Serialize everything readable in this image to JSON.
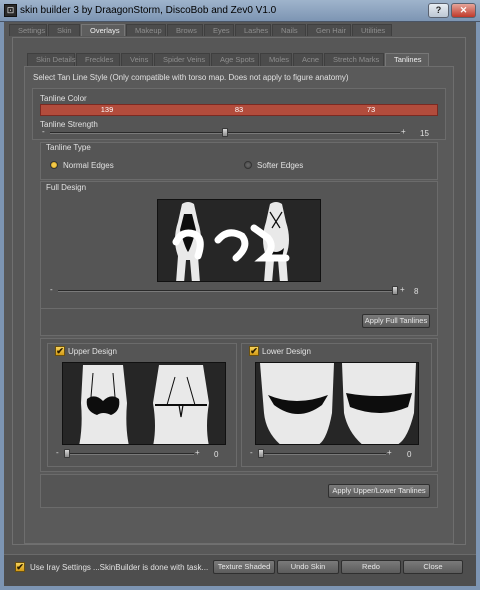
{
  "window": {
    "title": "skin builder 3 by DraagonStorm, DiscoBob and Zev0 V1.0",
    "help_glyph": "?",
    "close_glyph": "✕",
    "app_glyph": "⊡"
  },
  "main_tabs": [
    {
      "label": "Settings",
      "active": false
    },
    {
      "label": "Skin",
      "active": false
    },
    {
      "label": "Overlays",
      "active": true
    },
    {
      "label": "Makeup",
      "active": false
    },
    {
      "label": "Brows",
      "active": false
    },
    {
      "label": "Eyes",
      "active": false
    },
    {
      "label": "Lashes",
      "active": false
    },
    {
      "label": "Nails",
      "active": false
    },
    {
      "label": "Gen Hair",
      "active": false
    },
    {
      "label": "Utilities",
      "active": false
    }
  ],
  "sub_tabs": [
    {
      "label": "Skin Details",
      "active": false
    },
    {
      "label": "Freckles",
      "active": false
    },
    {
      "label": "Veins",
      "active": false
    },
    {
      "label": "Spider Veins",
      "active": false
    },
    {
      "label": "Age Spots",
      "active": false
    },
    {
      "label": "Moles",
      "active": false
    },
    {
      "label": "Acne",
      "active": false
    },
    {
      "label": "Stretch Marks",
      "active": false
    },
    {
      "label": "Tanlines",
      "active": true
    }
  ],
  "tanlines": {
    "hint": "Select Tan Line Style (Only compatible with  torso map. Does not apply to figure anatomy)",
    "color_label": "Tanline Color",
    "color_values": [
      "139",
      "83",
      "73"
    ],
    "color_hex": "#b24c3c",
    "strength_label": "Tanline Strength",
    "strength_value": "15",
    "strength_fraction": 0.5,
    "minus": "-",
    "plus": "+",
    "type_label": "Tanline Type",
    "type_options": [
      {
        "label": "Normal Edges",
        "selected": true
      },
      {
        "label": "Softer Edges",
        "selected": false
      }
    ],
    "full_design_label": "Full Design",
    "full_design_value": "8",
    "full_design_fraction": 1.0,
    "apply_full_button": "Apply Full Tanlines",
    "upper_design_label": "Upper Design",
    "upper_design_checked": true,
    "upper_design_value": "0",
    "upper_design_fraction": 0.0,
    "lower_design_label": "Lower Design",
    "lower_design_checked": true,
    "lower_design_value": "0",
    "lower_design_fraction": 0.0,
    "apply_upper_lower_button": "Apply Upper/Lower Tanlines",
    "check_glyph": "✔"
  },
  "footer": {
    "use_iray_label": "Use Iray Settings",
    "use_iray_checked": true,
    "status": "...SkinBuilder is done with task...",
    "buttons": [
      "Texture Shaded",
      "Undo Skin",
      "Redo",
      "Close"
    ]
  },
  "colors": {
    "accent_check": "#f3c94a",
    "tanline_color": "#b24c3c"
  }
}
